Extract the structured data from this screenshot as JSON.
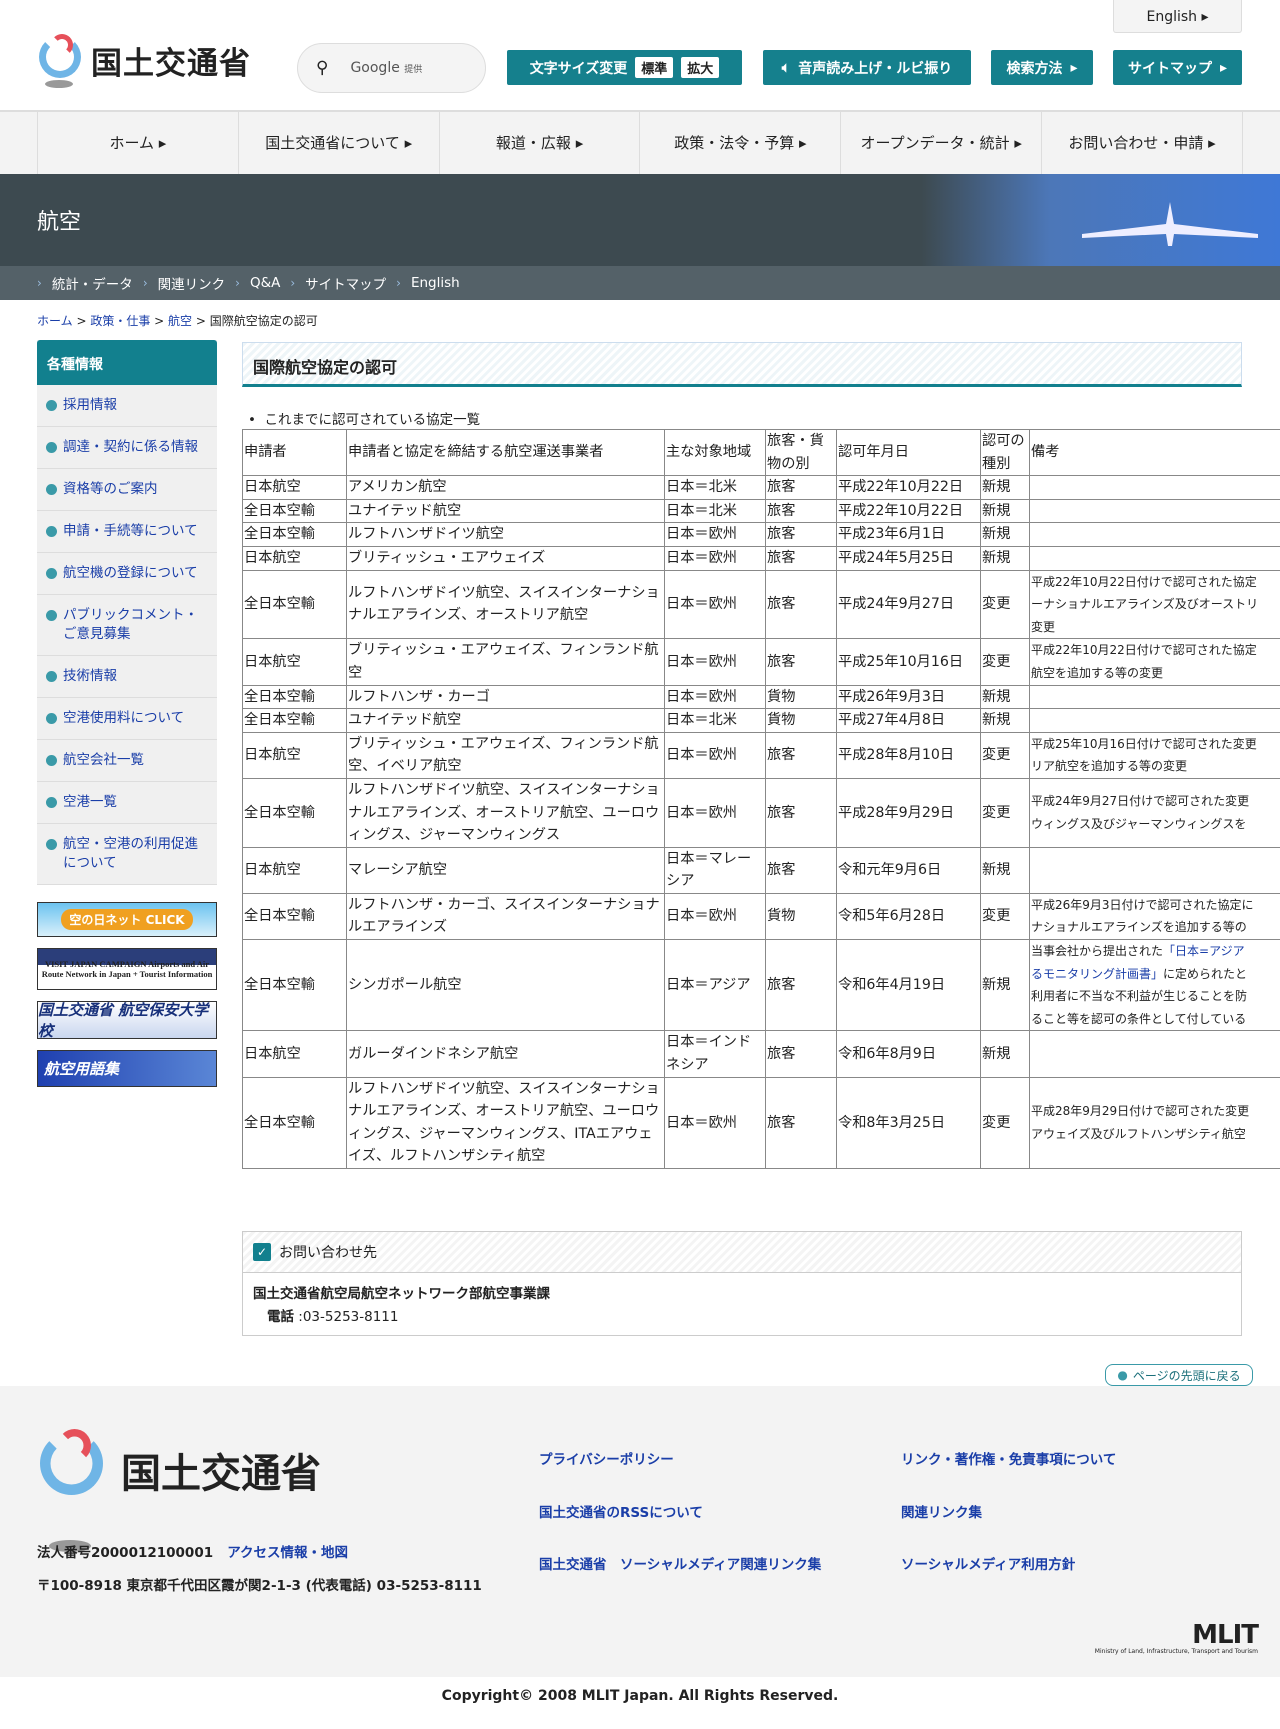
{
  "header": {
    "english": "English",
    "logo": "国土交通省",
    "search_brand": "Google",
    "search_sub": "提供",
    "font_size_label": "文字サイズ変更",
    "font_std": "標準",
    "font_large": "拡大",
    "speech": "音声読み上げ・ルビ振り",
    "search_method": "検索方法",
    "sitemap": "サイトマップ"
  },
  "nav": [
    "ホーム",
    "国土交通省について",
    "報道・広報",
    "政策・法令・予算",
    "オープンデータ・統計",
    "お問い合わせ・申請"
  ],
  "hero": {
    "title": "航空"
  },
  "sub_links": [
    "統計・データ",
    "関連リンク",
    "Q&A",
    "サイトマップ",
    "English"
  ],
  "breadcrumb": {
    "items": [
      "ホーム",
      "政策・仕事",
      "航空"
    ],
    "current": "国際航空協定の認可"
  },
  "sidebar": {
    "title": "各種情報",
    "items": [
      "採用情報",
      "調達・契約に係る情報",
      "資格等のご案内",
      "申請・手続等について",
      "航空機の登録について",
      "パブリックコメント・ご意見募集",
      "技術情報",
      "空港使用料について",
      "航空会社一覧",
      "空港一覧",
      "航空・空港の利用促進について"
    ],
    "banners": [
      "空の日ネット CLICK",
      "VISIT JAPAN CAMPAIGN Airports and Air Route Network in Japan + Tourist Information",
      "国土交通省 航空保安大学校",
      "航空用語集"
    ]
  },
  "main": {
    "title": "国際航空協定の認可",
    "bullet": "これまでに認可されている協定一覧",
    "headers": [
      "申請者",
      "申請者と協定を締結する航空運送事業者",
      "主な対象地域",
      "旅客・貨物の別",
      "認可年月日",
      "認可の種別",
      "備考"
    ],
    "rows": [
      [
        "日本航空",
        "アメリカン航空",
        "日本＝北米",
        "旅客",
        "平成22年10月22日",
        "新規",
        ""
      ],
      [
        "全日本空輸",
        "ユナイテッド航空",
        "日本＝北米",
        "旅客",
        "平成22年10月22日",
        "新規",
        ""
      ],
      [
        "全日本空輸",
        "ルフトハンザドイツ航空",
        "日本＝欧州",
        "旅客",
        "平成23年6月1日",
        "新規",
        ""
      ],
      [
        "日本航空",
        "ブリティッシュ・エアウェイズ",
        "日本＝欧州",
        "旅客",
        "平成24年5月25日",
        "新規",
        ""
      ],
      [
        "全日本空輸",
        "ルフトハンザドイツ航空、スイスインターナショナルエアラインズ、オーストリア航空",
        "日本＝欧州",
        "旅客",
        "平成24年9月27日",
        "変更",
        "平成22年10月22日付けで認可された協定\nーナショナルエアラインズ及びオーストリ\n変更"
      ],
      [
        "日本航空",
        "ブリティッシュ・エアウェイズ、フィンランド航空",
        "日本＝欧州",
        "旅客",
        "平成25年10月16日",
        "変更",
        "平成22年10月22日付けで認可された協定\n航空を追加する等の変更"
      ],
      [
        "全日本空輸",
        "ルフトハンザ・カーゴ",
        "日本＝欧州",
        "貨物",
        "平成26年9月3日",
        "新規",
        ""
      ],
      [
        "全日本空輸",
        "ユナイテッド航空",
        "日本＝北米",
        "貨物",
        "平成27年4月8日",
        "新規",
        ""
      ],
      [
        "日本航空",
        "ブリティッシュ・エアウェイズ、フィンランド航空、イベリア航空",
        "日本＝欧州",
        "旅客",
        "平成28年8月10日",
        "変更",
        "平成25年10月16日付けで認可された変更\nリア航空を追加する等の変更"
      ],
      [
        "全日本空輸",
        "ルフトハンザドイツ航空、スイスインターナショナルエアラインズ、オーストリア航空、ユーロウィングス、ジャーマンウィングス",
        "日本＝欧州",
        "旅客",
        "平成28年9月29日",
        "変更",
        "平成24年9月27日付けで認可された変更\nウィングス及びジャーマンウィングスを"
      ],
      [
        "日本航空",
        "マレーシア航空",
        "日本＝マレーシア",
        "旅客",
        "令和元年9月6日",
        "新規",
        ""
      ],
      [
        "全日本空輸",
        "ルフトハンザ・カーゴ、スイスインターナショナルエアラインズ",
        "日本＝欧州",
        "貨物",
        "令和5年6月28日",
        "変更",
        "平成26年9月3日付けで認可された協定に\nナショナルエアラインズを追加する等の"
      ],
      [
        "全日本空輸",
        "シンガポール航空",
        "日本＝アジア",
        "旅客",
        "令和6年4月19日",
        "新規",
        [
          {
            "t": "当事会社から提出された"
          },
          {
            "t": "「日本=アジア\nるモニタリング計画書」",
            "link": true
          },
          {
            "t": "に定められたと\n利用者に不当な不利益が生じることを防\nること等を認可の条件として付している"
          }
        ]
      ],
      [
        "日本航空",
        "ガルーダインドネシア航空",
        "日本＝インドネシア",
        "旅客",
        "令和6年8月9日",
        "新規",
        ""
      ],
      [
        "全日本空輸",
        "ルフトハンザドイツ航空、スイスインターナショナルエアラインズ、オーストリア航空、ユーロウィングス、ジャーマンウィングス、ITAエアウェイズ、ルフトハンザシティ航空",
        "日本＝欧州",
        "旅客",
        "令和8年3月25日",
        "変更",
        "平成28年9月29日付けで認可された変更\nアウェイズ及びルフトハンザシティ航空"
      ]
    ]
  },
  "contact": {
    "title": "お問い合わせ先",
    "dept": "国土交通省航空局航空ネットワーク部航空事業課",
    "tel_label": "電話",
    "tel": ":03-5253-8111"
  },
  "totop": "ページの先頭に戻る",
  "footer": {
    "logo": "国土交通省",
    "corp_no": "法人番号2000012100001",
    "access": "アクセス情報・地図",
    "address": "〒100-8918 東京都千代田区霞が関2-1-3 (代表電話) 03-5253-8111",
    "links": [
      "プライバシーポリシー",
      "リンク・著作権・免責事項について",
      "国土交通省のRSSについて",
      "関連リンク集",
      "国土交通省　ソーシャルメディア関連リンク集",
      "ソーシャルメディア利用方針"
    ],
    "mlit": "MLIT",
    "mlit_sub": "Ministry of Land, Infrastructure, Transport and Tourism",
    "copyright": "Copyright© 2008 MLIT Japan. All Rights Reserved."
  }
}
